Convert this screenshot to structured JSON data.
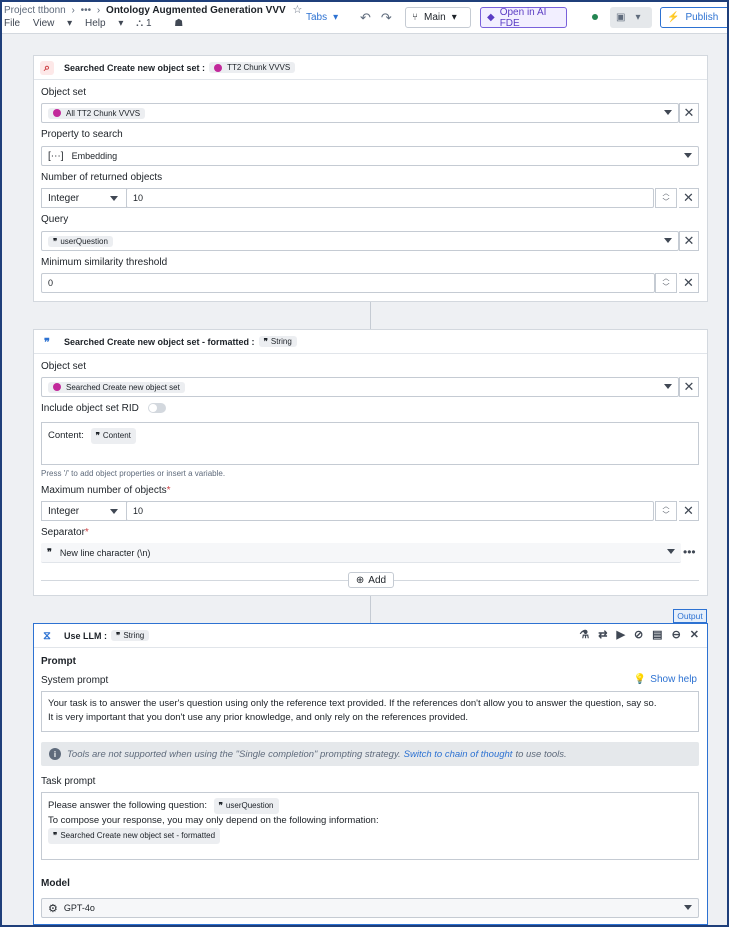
{
  "topbar": {
    "project": "Project ttbonn",
    "ellipsis": "•••",
    "title": "Ontology Augmented Generation VVV",
    "star": "☆",
    "menus": [
      "File",
      "View",
      "Help"
    ],
    "badge_count": "1",
    "tabs_label": "Tabs",
    "branch_label": "Main",
    "ai_fde_label": "Open in AI FDE",
    "publish_label": "Publish"
  },
  "card1": {
    "head_text": "Searched Create new object set :",
    "head_tag": "TT2 Chunk VVVS",
    "object_set_label": "Object set",
    "object_set_value": "All TT2 Chunk VVVS",
    "property_label": "Property to search",
    "property_value": "Embedding",
    "returned_label": "Number of returned objects",
    "returned_type": "Integer",
    "returned_value": "10",
    "query_label": "Query",
    "query_value": "userQuestion",
    "threshold_label": "Minimum similarity threshold",
    "threshold_value": "0"
  },
  "card2": {
    "head_text": "Searched Create new object set - formatted :",
    "head_tag": "String",
    "object_set_label": "Object set",
    "object_set_value": "Searched Create new object set",
    "include_rid_label": "Include object set RID",
    "content_label": "Content:",
    "content_tag": "Content",
    "hint": "Press '/' to add object properties or insert a variable.",
    "max_label": "Maximum number of objects",
    "max_type": "Integer",
    "max_value": "10",
    "separator_label": "Separator",
    "separator_value": "New line character (\\n)",
    "add_label": "Add"
  },
  "card3": {
    "output_badge": "Output",
    "head_text": "Use LLM :",
    "head_tag": "String",
    "prompt_title": "Prompt",
    "system_prompt_label": "System prompt",
    "show_help": "Show help",
    "system_line1": "Your task is to answer the user's question using only the reference text provided. If the references don't allow you to answer the question, say so.",
    "system_line2": "It is very important that you don't use any prior knowledge, and only rely on the references provided.",
    "info_text_a": "Tools are not supported when using the \"Single completion\" prompting strategy.",
    "info_link": "Switch to chain of thought",
    "info_text_b": "to use tools.",
    "task_prompt_label": "Task prompt",
    "task_line1": "Please answer the following question:",
    "task_tag1": "userQuestion",
    "task_line2": "To compose your response, you may only depend on the following information:",
    "task_tag2": "Searched Create new object set - formatted",
    "model_title": "Model",
    "model_value": "GPT-4o"
  }
}
